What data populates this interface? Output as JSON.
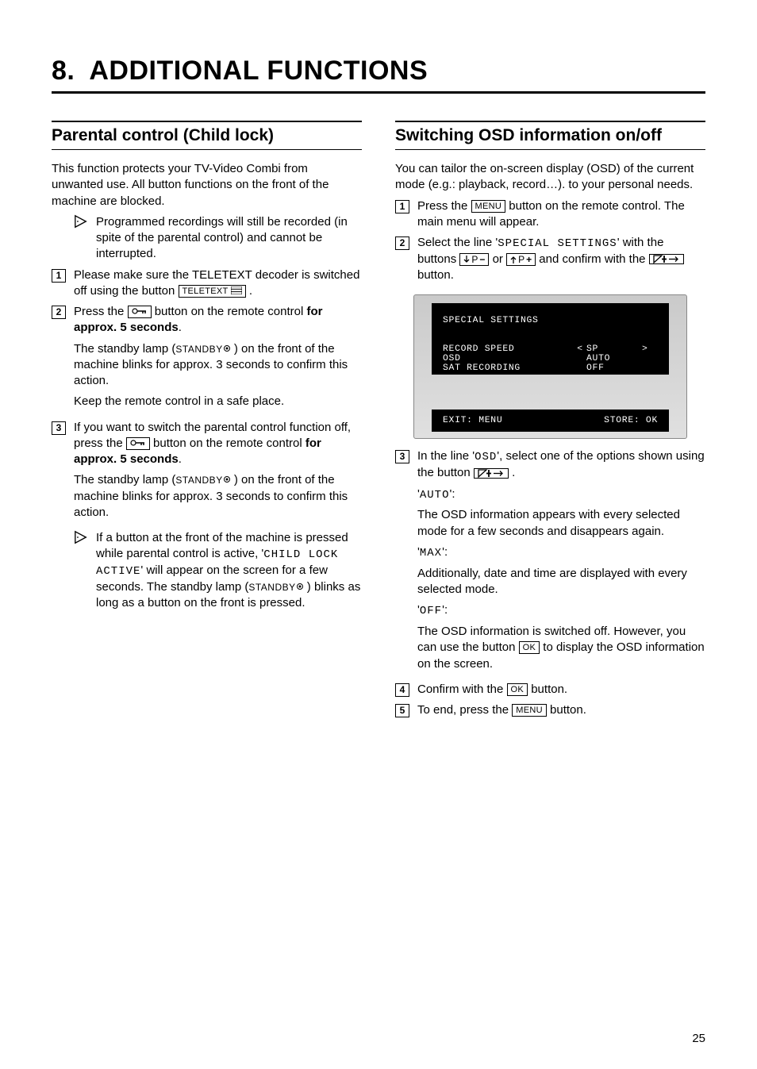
{
  "chapter": {
    "num": "8.",
    "title": "ADDITIONAL FUNCTIONS"
  },
  "page_number": "25",
  "left": {
    "title": "Parental control (Child lock)",
    "intro": "This function protects your TV-Video Combi from unwanted use. All button functions on the front of the machine are blocked.",
    "note1": "Programmed recordings will still be recorded (in spite of the parental control) and cannot be interrupted.",
    "step1_a": "Please make sure the TELETEXT decoder is switched off using the button ",
    "btn_teletext": "TELETEXT",
    "step1_b": " .",
    "step2_a": "Press the ",
    "step2_b": " button on the remote control ",
    "step2_bold": "for approx. 5 seconds",
    "step2_c": ".",
    "step2_p2a": "The standby lamp (",
    "standby_label": "STANDBY",
    "step2_p2b": " ) on the front of the machine blinks for approx. 3 seconds to confirm this action.",
    "step2_p3": "Keep the remote control in a safe place.",
    "step3_a": "If you want to switch the parental control function off, press the ",
    "step3_b": " button on the remote control ",
    "step3_bold": "for approx. 5 seconds",
    "step3_c": ".",
    "step3_p2a": "The standby lamp (",
    "step3_p2b": " ) on the front of the machine blinks for approx. 3 seconds to confirm this action.",
    "note2_a": "If a button at the front of the machine is pressed while parental control is active, '",
    "note2_code": "CHILD LOCK ACTIVE",
    "note2_b": "' will appear on the screen for a few seconds. The standby lamp (",
    "note2_c": " ) blinks as long as a button on the front is pressed."
  },
  "right": {
    "title": "Switching OSD information on/off",
    "intro": "You can tailor the on-screen display (OSD) of the current mode (e.g.: playback, record…). to your personal needs.",
    "step1_a": "Press the ",
    "btn_menu": "MENU",
    "step1_b": " button on the remote control. The main menu will appear.",
    "step2_a": "Select the line '",
    "step2_code": "SPECIAL SETTINGS",
    "step2_b": "' with the buttons ",
    "btn_p_minus_prefix": "P",
    "btn_p_plus_prefix": "P",
    "step2_c": " or ",
    "step2_d": " and confirm with the ",
    "step2_e": " button.",
    "screen": {
      "title": "SPECIAL SETTINGS",
      "rows": [
        {
          "label": "RECORD SPEED",
          "lt": "<",
          "val": "SP",
          "gt": ">"
        },
        {
          "label": "OSD",
          "lt": "",
          "val": "AUTO",
          "gt": ""
        },
        {
          "label": "SAT RECORDING",
          "lt": "",
          "val": "OFF",
          "gt": ""
        }
      ],
      "exit": "EXIT: MENU",
      "store": "STORE: OK"
    },
    "step3_a": "In the line '",
    "step3_code1": "OSD",
    "step3_b": "', select one of the options shown using the button ",
    "step3_c": " .",
    "opt_auto": "AUTO",
    "opt_auto_label": "':",
    "opt_auto_desc": "The OSD information appears with every selected mode for a few seconds and disappears again.",
    "opt_max": "MAX",
    "opt_max_desc": "Additionally, date and time are displayed with every selected mode.",
    "opt_off": "OFF",
    "opt_off_desc_a": "The OSD information is switched off. However, you can use the button ",
    "btn_ok": "OK",
    "opt_off_desc_b": " to display the OSD information on the screen.",
    "step4_a": "Confirm with the ",
    "step4_b": " button.",
    "step5_a": "To end, press the ",
    "step5_b": " button."
  }
}
